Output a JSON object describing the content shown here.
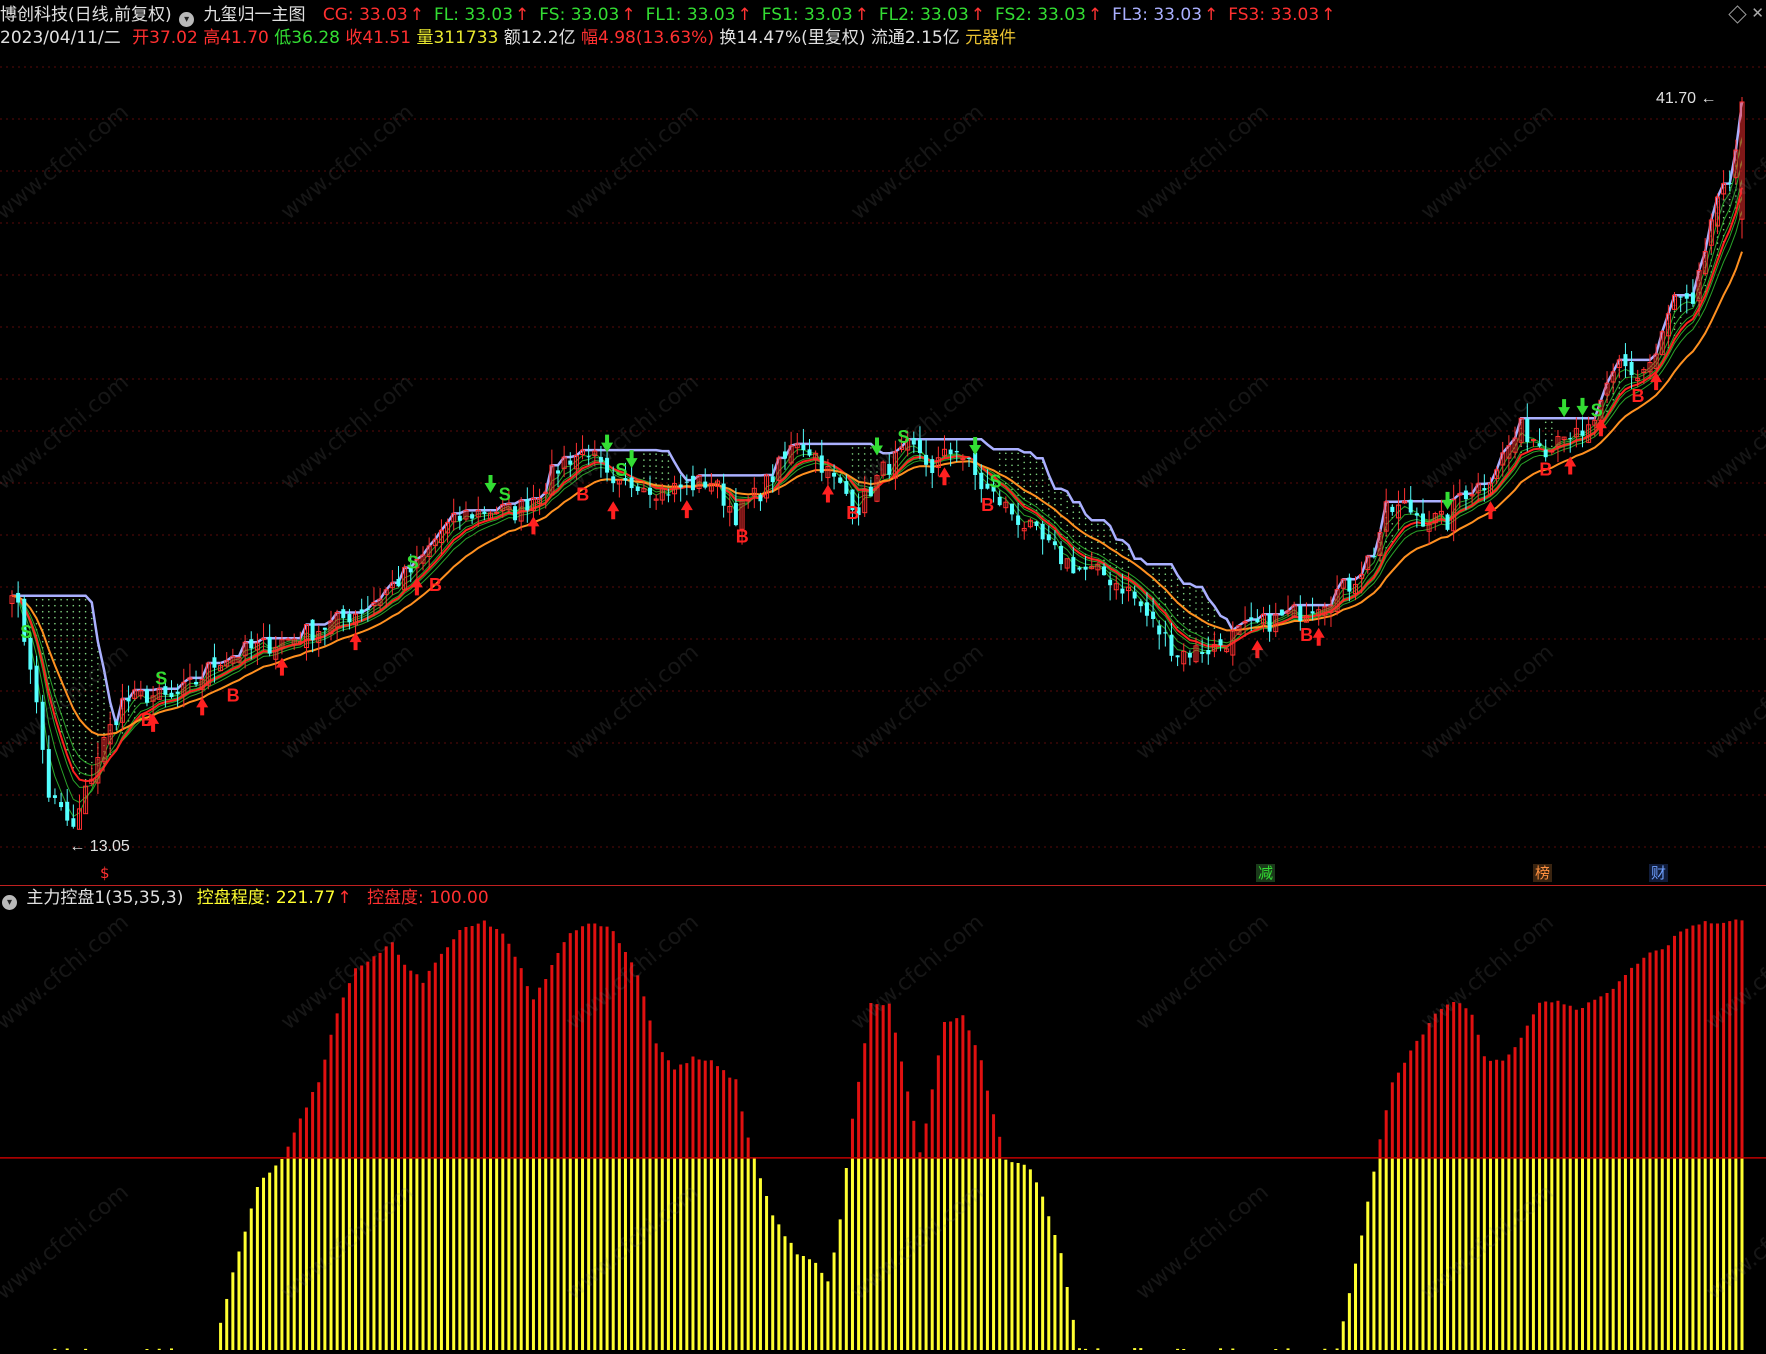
{
  "header": {
    "stock_title": "博创科技(日线,前复权)",
    "formula_name": "九玺归一主图",
    "indicators": [
      {
        "label": "CG: 33.03",
        "color": "#ff3030"
      },
      {
        "label": "FL: 33.03",
        "color": "#33dd33"
      },
      {
        "label": "FS: 33.03",
        "color": "#33dd33"
      },
      {
        "label": "FL1: 33.03",
        "color": "#33dd33"
      },
      {
        "label": "FS1: 33.03",
        "color": "#33dd33"
      },
      {
        "label": "FL2: 33.03",
        "color": "#33dd33"
      },
      {
        "label": "FS2: 33.03",
        "color": "#33dd33"
      },
      {
        "label": "FL3: 33.03",
        "color": "#aab0ff"
      },
      {
        "label": "FS3: 33.03",
        "color": "#ff3030"
      }
    ]
  },
  "quote": {
    "date": "2023/04/11/二",
    "open_label": "开",
    "open": "37.02",
    "high_label": "高",
    "high": "41.70",
    "low_label": "低",
    "low": "36.28",
    "close_label": "收",
    "close": "41.51",
    "vol_label": "量",
    "vol": "311733",
    "amount_label": "额",
    "amount": "12.2亿",
    "change_label": "幅",
    "change": "4.98(13.63%)",
    "turnover": "换14.47%(里复权)",
    "float": "流通2.15亿",
    "sector": "元器件"
  },
  "chart_marks": {
    "high_label": "41.70",
    "low_label": "13.05"
  },
  "events": [
    {
      "text": "$",
      "color": "#ff3030"
    },
    {
      "text": "减",
      "color": "#33dd33"
    },
    {
      "text": "榜",
      "color": "#ff9040"
    },
    {
      "text": "财",
      "color": "#6fa0ff"
    }
  ],
  "sub_panel": {
    "name": "主力控盘1(35,35,3)",
    "label1": "控盘程度: 221.77",
    "label2": "控盘度: 100.00",
    "colors": {
      "upper": "#e01010",
      "lower": "#ffff30",
      "ref_line": "#c00000"
    }
  },
  "watermark": "www.cfchi.com",
  "chart_data": [
    {
      "type": "candlestick",
      "title": "九玺归一主图",
      "ylim": [
        13.05,
        41.7
      ],
      "close_anchor_points": [
        [
          0,
          23.0
        ],
        [
          3,
          20.0
        ],
        [
          6,
          15.0
        ],
        [
          10,
          13.6
        ],
        [
          14,
          16.5
        ],
        [
          18,
          18.5
        ],
        [
          22,
          18.8
        ],
        [
          26,
          18.6
        ],
        [
          30,
          19.3
        ],
        [
          34,
          20.2
        ],
        [
          40,
          20.6
        ],
        [
          46,
          21.0
        ],
        [
          52,
          21.5
        ],
        [
          58,
          22.2
        ],
        [
          62,
          23.0
        ],
        [
          66,
          23.7
        ],
        [
          70,
          25.1
        ],
        [
          74,
          25.7
        ],
        [
          78,
          25.9
        ],
        [
          82,
          25.8
        ],
        [
          86,
          26.6
        ],
        [
          90,
          27.8
        ],
        [
          94,
          28.2
        ],
        [
          98,
          26.6
        ],
        [
          102,
          27.0
        ],
        [
          106,
          26.6
        ],
        [
          110,
          26.8
        ],
        [
          114,
          27.0
        ],
        [
          118,
          25.7
        ],
        [
          122,
          26.6
        ],
        [
          126,
          27.8
        ],
        [
          128,
          28.6
        ],
        [
          131,
          28.0
        ],
        [
          134,
          27.0
        ],
        [
          138,
          26.0
        ],
        [
          142,
          27.4
        ],
        [
          146,
          28.2
        ],
        [
          150,
          27.5
        ],
        [
          154,
          28.3
        ],
        [
          158,
          26.8
        ],
        [
          162,
          26.0
        ],
        [
          166,
          25.1
        ],
        [
          170,
          24.2
        ],
        [
          174,
          23.6
        ],
        [
          178,
          23.4
        ],
        [
          182,
          22.8
        ],
        [
          186,
          21.5
        ],
        [
          190,
          20.4
        ],
        [
          196,
          20.6
        ],
        [
          200,
          21.2
        ],
        [
          205,
          21.6
        ],
        [
          210,
          22.0
        ],
        [
          214,
          22.5
        ],
        [
          218,
          23.0
        ],
        [
          222,
          24.3
        ],
        [
          224,
          25.8
        ],
        [
          227,
          26.0
        ],
        [
          230,
          25.6
        ],
        [
          234,
          25.4
        ],
        [
          236,
          26.5
        ],
        [
          240,
          26.9
        ],
        [
          242,
          27.6
        ],
        [
          246,
          29.0
        ],
        [
          250,
          28.3
        ],
        [
          253,
          29.0
        ],
        [
          256,
          28.5
        ],
        [
          259,
          29.8
        ],
        [
          262,
          31.5
        ],
        [
          265,
          31.0
        ],
        [
          268,
          31.8
        ],
        [
          271,
          34.0
        ],
        [
          274,
          33.5
        ],
        [
          277,
          37.0
        ],
        [
          280,
          38.5
        ],
        [
          282,
          41.51
        ]
      ],
      "ma_series": [
        {
          "name": "CG",
          "color": "#ff3030"
        },
        {
          "name": "FL",
          "color": "#33dd33"
        },
        {
          "name": "FS",
          "color": "#33dd33"
        },
        {
          "name": "FL1",
          "color": "#33dd33"
        },
        {
          "name": "FS1",
          "color": "#33dd33"
        },
        {
          "name": "FL2",
          "color": "#33dd33"
        },
        {
          "name": "FS2",
          "color": "#33dd33"
        },
        {
          "name": "FL3",
          "color": "#aab0ff"
        },
        {
          "name": "FS3",
          "color": "#ff3030"
        }
      ],
      "signals_B": [
        20,
        34,
        67,
        91,
        117,
        135,
        157,
        209,
        248,
        263
      ],
      "signals_S": [
        2,
        24,
        65,
        80,
        99,
        145,
        160,
        258
      ],
      "up_arrows": [
        23,
        31,
        44,
        56,
        66,
        85,
        98,
        110,
        133,
        152,
        203,
        213,
        241,
        254,
        259,
        268
      ],
      "down_arrows": [
        78,
        97,
        101,
        141,
        157,
        234,
        253,
        256
      ]
    },
    {
      "type": "bar",
      "title": "主力控盘1(35,35,3)",
      "ref_level": 100,
      "ylim": [
        0,
        221.77
      ],
      "anchor_points": [
        [
          0,
          0
        ],
        [
          33,
          0
        ],
        [
          36,
          40
        ],
        [
          40,
          85
        ],
        [
          44,
          100
        ],
        [
          47,
          120
        ],
        [
          50,
          140
        ],
        [
          53,
          175
        ],
        [
          56,
          198
        ],
        [
          59,
          205
        ],
        [
          62,
          212
        ],
        [
          64,
          200
        ],
        [
          67,
          192
        ],
        [
          70,
          206
        ],
        [
          73,
          218
        ],
        [
          77,
          223
        ],
        [
          80,
          217
        ],
        [
          83,
          198
        ],
        [
          85,
          182
        ],
        [
          88,
          200
        ],
        [
          91,
          218
        ],
        [
          95,
          223
        ],
        [
          98,
          218
        ],
        [
          102,
          196
        ],
        [
          105,
          160
        ],
        [
          108,
          146
        ],
        [
          111,
          152
        ],
        [
          114,
          150
        ],
        [
          118,
          140
        ],
        [
          120,
          110
        ],
        [
          122,
          90
        ],
        [
          124,
          70
        ],
        [
          126,
          60
        ],
        [
          128,
          50
        ],
        [
          131,
          45
        ],
        [
          133,
          35
        ],
        [
          135,
          68
        ],
        [
          137,
          120
        ],
        [
          140,
          180
        ],
        [
          143,
          180
        ],
        [
          146,
          135
        ],
        [
          148,
          102
        ],
        [
          150,
          135
        ],
        [
          152,
          170
        ],
        [
          155,
          175
        ],
        [
          158,
          150
        ],
        [
          160,
          122
        ],
        [
          162,
          100
        ],
        [
          166,
          95
        ],
        [
          168,
          80
        ],
        [
          171,
          50
        ],
        [
          174,
          0
        ],
        [
          216,
          0
        ],
        [
          220,
          60
        ],
        [
          223,
          110
        ],
        [
          225,
          140
        ],
        [
          228,
          155
        ],
        [
          232,
          175
        ],
        [
          235,
          182
        ],
        [
          238,
          175
        ],
        [
          240,
          152
        ],
        [
          243,
          150
        ],
        [
          246,
          162
        ],
        [
          249,
          180
        ],
        [
          252,
          182
        ],
        [
          255,
          178
        ],
        [
          257,
          180
        ],
        [
          260,
          185
        ],
        [
          263,
          195
        ],
        [
          266,
          205
        ],
        [
          269,
          208
        ],
        [
          272,
          218
        ],
        [
          275,
          222
        ],
        [
          278,
          223
        ],
        [
          282,
          224
        ]
      ]
    }
  ]
}
